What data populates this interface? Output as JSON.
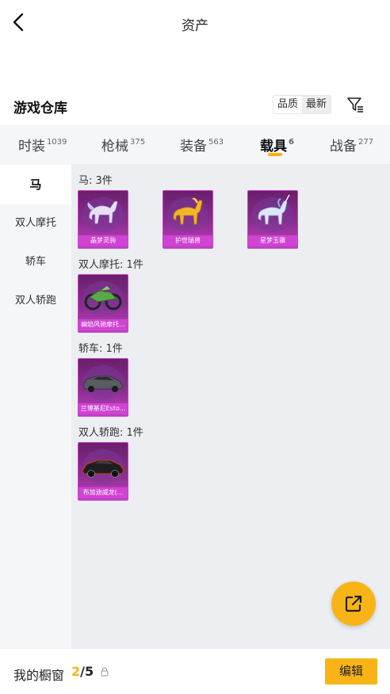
{
  "header": {
    "title": "资产",
    "back_icon": "chevron-left-icon"
  },
  "warehouse": {
    "title": "游戏仓库",
    "sort": [
      "品质",
      "最新"
    ],
    "sort_selected": "最新",
    "filter_icon": "filter-icon"
  },
  "tabs": [
    {
      "label": "时装",
      "count": "1039"
    },
    {
      "label": "枪械",
      "count": "375"
    },
    {
      "label": "装备",
      "count": "563"
    },
    {
      "label": "载具",
      "count": "6",
      "active": true
    },
    {
      "label": "战备",
      "count": "277"
    }
  ],
  "sidebar": {
    "items": [
      {
        "label": "马",
        "active": true
      },
      {
        "label": "双人摩托"
      },
      {
        "label": "轿车"
      },
      {
        "label": "双人轿跑"
      }
    ]
  },
  "groups": [
    {
      "label": "马: 3件",
      "items": [
        {
          "name": "晶梦灵驹",
          "art": "crystal-horse"
        },
        {
          "name": "护世瑞兽",
          "art": "golden-qilin"
        },
        {
          "name": "星梦玉骥",
          "art": "star-unicorn"
        }
      ]
    },
    {
      "label": "双人摩托: 1件",
      "items": [
        {
          "name": "幽焰风驰摩托...",
          "art": "motorcycle"
        }
      ]
    },
    {
      "label": "轿车: 1件",
      "items": [
        {
          "name": "兰博基尼Esto...",
          "art": "sedan"
        }
      ]
    },
    {
      "label": "双人轿跑: 1件",
      "items": [
        {
          "name": "布加迪威龙(...",
          "art": "supercar"
        }
      ]
    }
  ],
  "fab": {
    "icon": "share-icon"
  },
  "bottom": {
    "window_label": "我的橱窗",
    "window_current": "2",
    "window_total": "/5",
    "lock_icon": "lock-icon",
    "edit_label": "编辑"
  },
  "colors": {
    "accent": "#f8b417",
    "card_purple": "#8b2d8f",
    "card_label": "#d043d3"
  }
}
